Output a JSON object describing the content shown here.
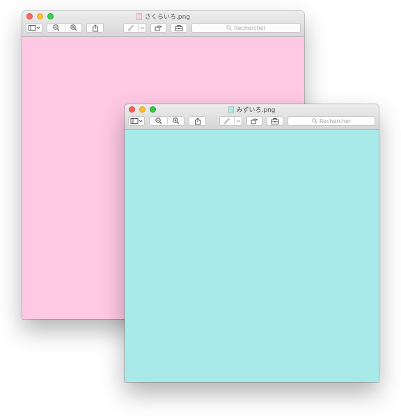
{
  "windows": [
    {
      "id": "back",
      "title": "さくらいろ.png",
      "image_color": "#ffc9e4",
      "search_placeholder": "Rechercher"
    },
    {
      "id": "front",
      "title": "みずいろ.png",
      "image_color": "#a8eaea",
      "search_placeholder": "Rechercher"
    }
  ],
  "toolbar_icons": [
    "sidebar-icon",
    "chevron-down-icon",
    "zoom-out-icon",
    "zoom-in-icon",
    "share-icon",
    "markup-pen-icon",
    "rotate-icon",
    "toolbox-icon",
    "search-icon"
  ],
  "colors": {
    "close": "#fc5f57",
    "minimize": "#fdbc2e",
    "zoom": "#34c84a"
  }
}
